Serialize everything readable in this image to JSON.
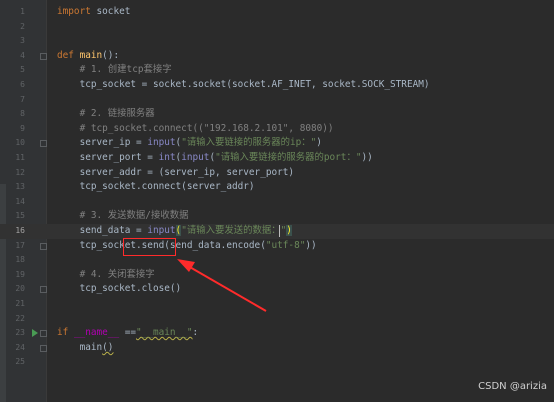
{
  "editor": {
    "lines": [
      {
        "num": "1",
        "segments": [
          {
            "t": "import",
            "c": "kw"
          },
          {
            "t": " socket",
            "c": ""
          }
        ]
      },
      {
        "num": "2",
        "segments": []
      },
      {
        "num": "3",
        "segments": []
      },
      {
        "num": "4",
        "segments": [
          {
            "t": "def ",
            "c": "kw"
          },
          {
            "t": "main",
            "c": "fn"
          },
          {
            "t": "():",
            "c": ""
          }
        ]
      },
      {
        "num": "5",
        "segments": [
          {
            "t": "    # 1. 创建tcp套接字",
            "c": "cm"
          }
        ]
      },
      {
        "num": "6",
        "segments": [
          {
            "t": "    tcp_socket = socket.socket(socket.AF_INET, socket.SOCK_STREAM)",
            "c": ""
          }
        ]
      },
      {
        "num": "7",
        "segments": []
      },
      {
        "num": "8",
        "segments": [
          {
            "t": "    # 2. 链接服务器",
            "c": "cm"
          }
        ]
      },
      {
        "num": "9",
        "segments": [
          {
            "t": "    # tcp_socket.connect((\"192.168.2.101\", 8080))",
            "c": "cm"
          }
        ]
      },
      {
        "num": "10",
        "segments": [
          {
            "t": "    server_ip = ",
            "c": ""
          },
          {
            "t": "input",
            "c": "bi"
          },
          {
            "t": "(",
            "c": ""
          },
          {
            "t": "\"请输入要链接的服务器的ip：\"",
            "c": "str"
          },
          {
            "t": ")",
            "c": ""
          }
        ]
      },
      {
        "num": "11",
        "segments": [
          {
            "t": "    server_port = ",
            "c": ""
          },
          {
            "t": "int",
            "c": "bi"
          },
          {
            "t": "(",
            "c": ""
          },
          {
            "t": "input",
            "c": "bi"
          },
          {
            "t": "(",
            "c": ""
          },
          {
            "t": "\"请输入要链接的服务器的port：\"",
            "c": "str"
          },
          {
            "t": "))",
            "c": ""
          }
        ]
      },
      {
        "num": "12",
        "segments": [
          {
            "t": "    server_addr = (server_ip, server_port)",
            "c": ""
          }
        ]
      },
      {
        "num": "13",
        "segments": [
          {
            "t": "    tcp_socket.connect(server_addr)",
            "c": ""
          }
        ]
      },
      {
        "num": "14",
        "segments": []
      },
      {
        "num": "15",
        "segments": [
          {
            "t": "    # 3. 发送数据/接收数据",
            "c": "cm"
          }
        ]
      },
      {
        "num": "16",
        "current": true,
        "segments": [
          {
            "t": "    send_data = ",
            "c": ""
          },
          {
            "t": "input",
            "c": "bi"
          },
          {
            "t": "(",
            "c": "brace-hl"
          },
          {
            "t": "\"请输入要发送的数据：\"",
            "c": "str"
          },
          {
            "t": ")",
            "c": "brace-hl"
          }
        ]
      },
      {
        "num": "17",
        "segments": [
          {
            "t": "    tcp_socket.send(send_data.encode(",
            "c": ""
          },
          {
            "t": "\"utf-8\"",
            "c": "str"
          },
          {
            "t": "))",
            "c": ""
          }
        ]
      },
      {
        "num": "18",
        "segments": []
      },
      {
        "num": "19",
        "segments": [
          {
            "t": "    # 4. 关闭套接字",
            "c": "cm"
          }
        ]
      },
      {
        "num": "20",
        "segments": [
          {
            "t": "    tcp_socket.close()",
            "c": ""
          }
        ]
      },
      {
        "num": "21",
        "segments": []
      },
      {
        "num": "22",
        "segments": []
      },
      {
        "num": "23",
        "run": true,
        "segments": [
          {
            "t": "if ",
            "c": "kw"
          },
          {
            "t": "__name__",
            "c": "dun"
          },
          {
            "t": " ==",
            "c": ""
          },
          {
            "t": "\"__main__\"",
            "c": "str squiggle"
          },
          {
            "t": ":",
            "c": ""
          }
        ]
      },
      {
        "num": "24",
        "segments": [
          {
            "t": "    main",
            "c": ""
          },
          {
            "t": "()",
            "c": "squiggle"
          }
        ]
      },
      {
        "num": "25",
        "segments": []
      }
    ]
  },
  "watermark": "CSDN @arizia",
  "colors": {
    "background": "#2b2b2b",
    "gutter": "#313335",
    "keyword": "#cc7832",
    "function": "#ffc66d",
    "comment": "#808080",
    "string": "#6a8759",
    "builtin": "#8888c6",
    "annotation_red": "#ff2b2b"
  },
  "icons": {
    "run_gutter": "run-triangle-icon",
    "fold": "fold-marker-icon"
  }
}
